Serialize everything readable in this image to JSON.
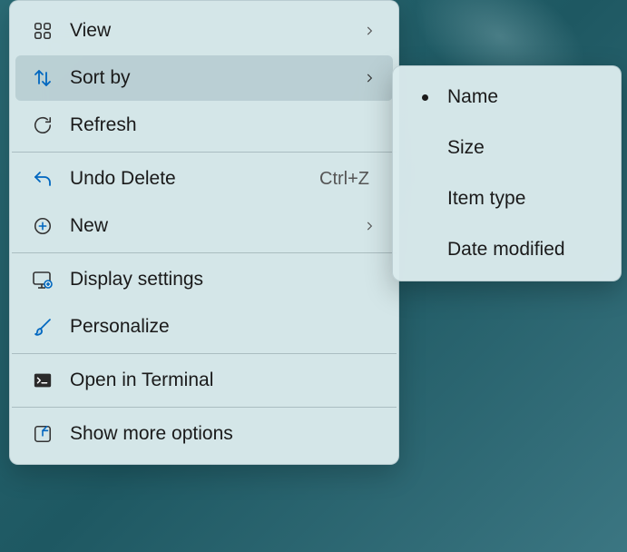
{
  "menu": {
    "view": {
      "label": "View"
    },
    "sort_by": {
      "label": "Sort by"
    },
    "refresh": {
      "label": "Refresh"
    },
    "undo_delete": {
      "label": "Undo Delete",
      "shortcut": "Ctrl+Z"
    },
    "new": {
      "label": "New"
    },
    "display_settings": {
      "label": "Display settings"
    },
    "personalize": {
      "label": "Personalize"
    },
    "open_in_terminal": {
      "label": "Open in Terminal"
    },
    "show_more_options": {
      "label": "Show more options"
    }
  },
  "submenu": {
    "name": {
      "label": "Name",
      "selected": true
    },
    "size": {
      "label": "Size",
      "selected": false
    },
    "item_type": {
      "label": "Item type",
      "selected": false
    },
    "date_modified": {
      "label": "Date modified",
      "selected": false
    }
  }
}
